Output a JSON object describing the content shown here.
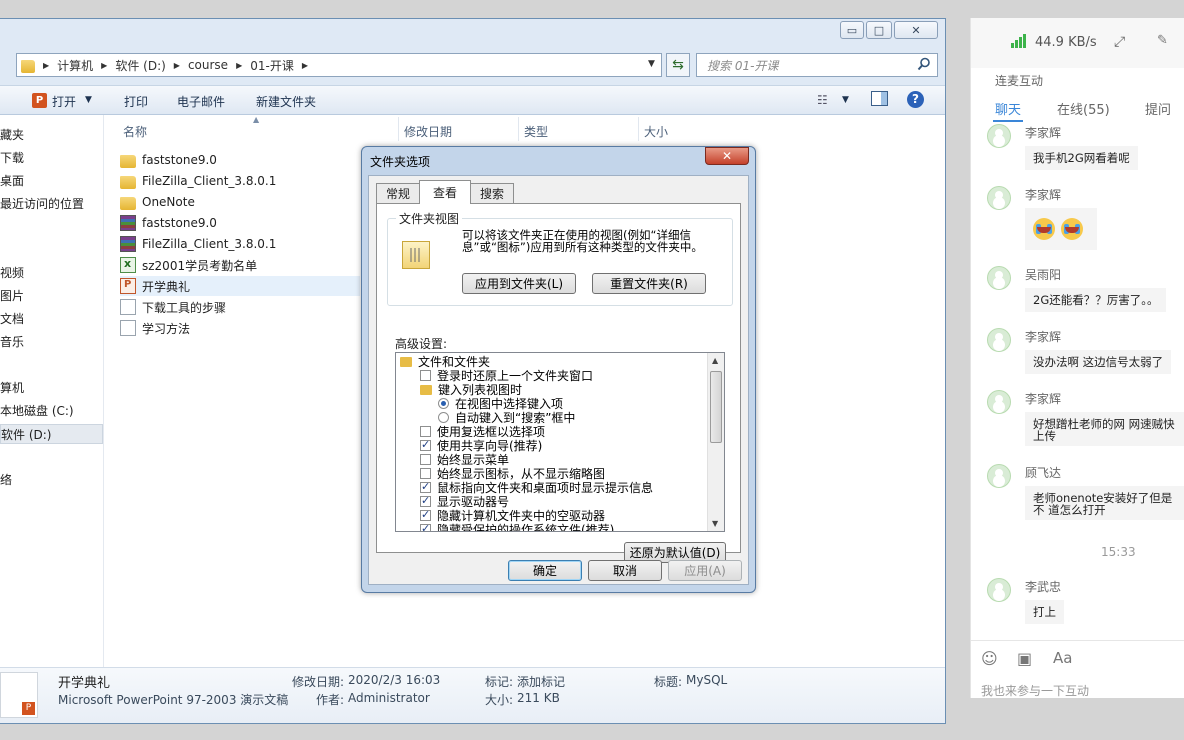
{
  "explorer": {
    "window_controls": {
      "minimize": "▭",
      "maximize": "□",
      "close": "✕"
    },
    "breadcrumb": [
      "计算机",
      "软件 (D:)",
      "course",
      "01-开课"
    ],
    "search_placeholder": "搜索 01-开课",
    "toolbar": {
      "open": "打开",
      "print": "打印",
      "email": "电子邮件",
      "new_folder": "新建文件夹"
    },
    "sidebar": {
      "items": [
        "藏夹",
        "下载",
        "桌面",
        "最近访问的位置",
        "视频",
        "图片",
        "文档",
        "音乐",
        "算机",
        "本地磁盘 (C:)",
        "软件 (D:)",
        "络"
      ]
    },
    "columns": {
      "name": "名称",
      "modified": "修改日期",
      "type": "类型",
      "size": "大小"
    },
    "files": [
      {
        "name": "faststone9.0",
        "icon": "folder-icon"
      },
      {
        "name": "FileZilla_Client_3.8.0.1",
        "icon": "folder-icon"
      },
      {
        "name": "OneNote",
        "icon": "folder-icon"
      },
      {
        "name": "faststone9.0",
        "icon": "rar-icon"
      },
      {
        "name": "FileZilla_Client_3.8.0.1",
        "icon": "rar-icon"
      },
      {
        "name": "sz2001学员考勤名单",
        "icon": "excel-icon"
      },
      {
        "name": "开学典礼",
        "icon": "powerpoint-icon"
      },
      {
        "name": "下载工具的步骤",
        "icon": "text-file-icon"
      },
      {
        "name": "学习方法",
        "icon": "text-file-icon"
      }
    ],
    "status": {
      "file_name": "开学典礼",
      "file_type": "Microsoft PowerPoint 97-2003 演示文稿",
      "modified_label": "修改日期:",
      "modified_value": "2020/2/3 16:03",
      "author_label": "作者:",
      "author_value": "Administrator",
      "tags_label": "标记:",
      "tags_value": "添加标记",
      "size_label": "大小:",
      "size_value": "211 KB",
      "title_label": "标题:",
      "title_value": "MySQL"
    }
  },
  "dialog": {
    "title": "文件夹选项",
    "close": "✕",
    "tabs": [
      "常规",
      "查看",
      "搜索"
    ],
    "folder_views_label": "文件夹视图",
    "folder_views_desc": "可以将该文件夹正在使用的视图(例如“详细信息”或“图标”)应用到所有这种类型的文件夹中。",
    "apply_button": "应用到文件夹(L)",
    "reset_button": "重置文件夹(R)",
    "advanced_label": "高级设置:",
    "advanced_items": [
      {
        "text": "文件和文件夹",
        "kind": "folder"
      },
      {
        "text": "登录时还原上一个文件夹窗口",
        "kind": "checkbox",
        "checked": false
      },
      {
        "text": "键入列表视图时",
        "kind": "folder"
      },
      {
        "text": "在视图中选择键入项",
        "kind": "radio",
        "checked": true
      },
      {
        "text": "自动键入到“搜索”框中",
        "kind": "radio",
        "checked": false
      },
      {
        "text": "使用复选框以选择项",
        "kind": "checkbox",
        "checked": false
      },
      {
        "text": "使用共享向导(推荐)",
        "kind": "checkbox",
        "checked": true
      },
      {
        "text": "始终显示菜单",
        "kind": "checkbox",
        "checked": false
      },
      {
        "text": "始终显示图标，从不显示缩略图",
        "kind": "checkbox",
        "checked": false
      },
      {
        "text": "鼠标指向文件夹和桌面项时显示提示信息",
        "kind": "checkbox",
        "checked": true
      },
      {
        "text": "显示驱动器号",
        "kind": "checkbox",
        "checked": true
      },
      {
        "text": "隐藏计算机文件夹中的空驱动器",
        "kind": "checkbox",
        "checked": true
      },
      {
        "text": "隐藏受保护的操作系统文件(推荐)",
        "kind": "checkbox",
        "checked": true
      }
    ],
    "restore_defaults": "还原为默认值(D)",
    "ok": "确定",
    "cancel": "取消",
    "apply": "应用(A)"
  },
  "chat": {
    "speed": "44.9 KB/s",
    "section_title": "连麦互动",
    "tabs": [
      "聊天",
      "在线(55)",
      "提问"
    ],
    "messages": [
      {
        "name": "李家辉",
        "text": "我手机2G网看着呢"
      },
      {
        "name": "李家辉",
        "text": ""
      },
      {
        "name": "吴雨阳",
        "text": "2G还能看？？厉害了。。"
      },
      {
        "name": "李家辉",
        "text": "没办法啊 这边信号太弱了"
      },
      {
        "name": "李家辉",
        "text": "好想蹭杜老师的网 网速贼快 上传"
      },
      {
        "name": "顾飞达",
        "text": "老师onenote安装好了但是不 道怎么打开"
      },
      {
        "name": "李武忠",
        "text": "打上"
      }
    ],
    "time": "15:33",
    "input_placeholder": "我也来参与一下互动"
  }
}
